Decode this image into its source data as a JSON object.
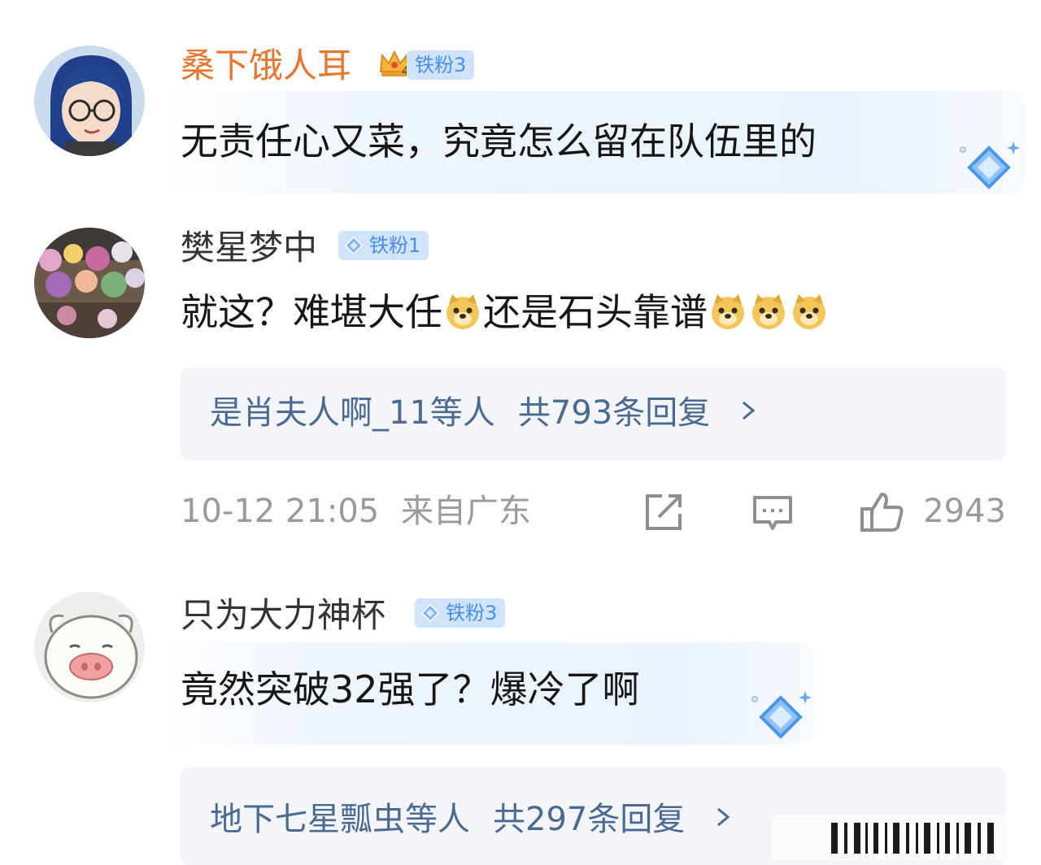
{
  "comments": [
    {
      "username": "桑下饿人耳",
      "badge": "铁粉3",
      "badge_level": "4",
      "text": "无责任心又菜，究竟怎么留在队伍里的"
    },
    {
      "username": "樊星梦中",
      "badge": "铁粉1",
      "text_part1": "就这？难堪大任",
      "text_part2": "还是石头靠谱",
      "reply_summary": "是肖夫人啊_11等人",
      "reply_count": "共793条回复",
      "time": "10-12 21:05",
      "location": "来自广东",
      "likes": "2943"
    },
    {
      "username": "只为大力神杯",
      "badge": "铁粉3",
      "text": "竟然突破32强了？爆冷了啊",
      "reply_summary": "地下七星瓢虫等人",
      "reply_count": "共297条回复"
    }
  ],
  "icons": {
    "chevron": "chevron-right-icon",
    "share": "share-icon",
    "comment": "comment-icon",
    "like": "thumbs-up-icon"
  },
  "colors": {
    "vip_name": "#e8762f",
    "reply_link": "#4b6a92",
    "badge_bg": "#cfe3fb",
    "badge_text": "#4a8ee8"
  }
}
